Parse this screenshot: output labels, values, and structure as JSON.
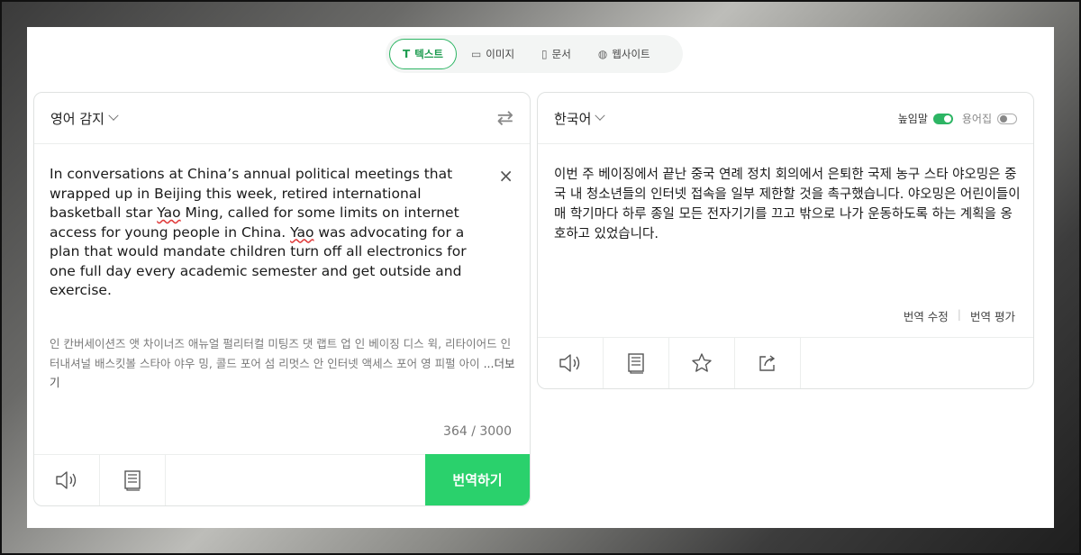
{
  "modes": [
    {
      "label": "텍스트",
      "icon": "text-icon",
      "glyph": "T"
    },
    {
      "label": "이미지",
      "icon": "image-icon",
      "glyph": "▭"
    },
    {
      "label": "문서",
      "icon": "document-icon",
      "glyph": "▯"
    },
    {
      "label": "웹사이트",
      "icon": "globe-icon",
      "glyph": "◍"
    }
  ],
  "source": {
    "language": "영어 감지",
    "text_part1": "In conversations at China’s annual political meetings that wrapped up in Beijing this week, retired international basketball star ",
    "text_yao1": "Yao",
    "text_part2": " Ming, called for some limits on internet access for young people in China. ",
    "text_yao2": "Yao",
    "text_part3": " was advocating for a plan that would mandate children turn off all electronics for one full day every academic semester and get outside and exercise.",
    "pronunciation": "인 칸버세이션즈 앳 차이너즈 애뉴얼 펄리터컬 미팅즈 댓 랩트 업 인 베이징 디스 윅, 리타이어드 인터내셔널 배스킷볼 스타아 야우 밍, 콜드 포어 섬 리멋스 안 인터넷 액세스 포어 영 피펄 아이 ",
    "more_label": "...더보기",
    "count": "364 / 3000",
    "translate_label": "번역하기"
  },
  "target": {
    "language": "한국어",
    "honorific_label": "높임말",
    "honorific_on": true,
    "glossary_label": "용어집",
    "glossary_on": false,
    "text": "이번 주 베이징에서 끝난 중국 연례 정치 회의에서 은퇴한 국제 농구 스타 야오밍은 중국 내 청소년들의 인터넷 접속을 일부 제한할 것을 촉구했습니다. 야오밍은 어린이들이 매 학기마다 하루 종일 모든 전자기기를 끄고 밖으로 나가 운동하도록 하는 계획을 옹호하고 있었습니다.",
    "edit_label": "번역 수정",
    "rate_label": "번역 평가"
  },
  "colors": {
    "accent": "#2db564",
    "translate_button": "#2ad16c"
  }
}
